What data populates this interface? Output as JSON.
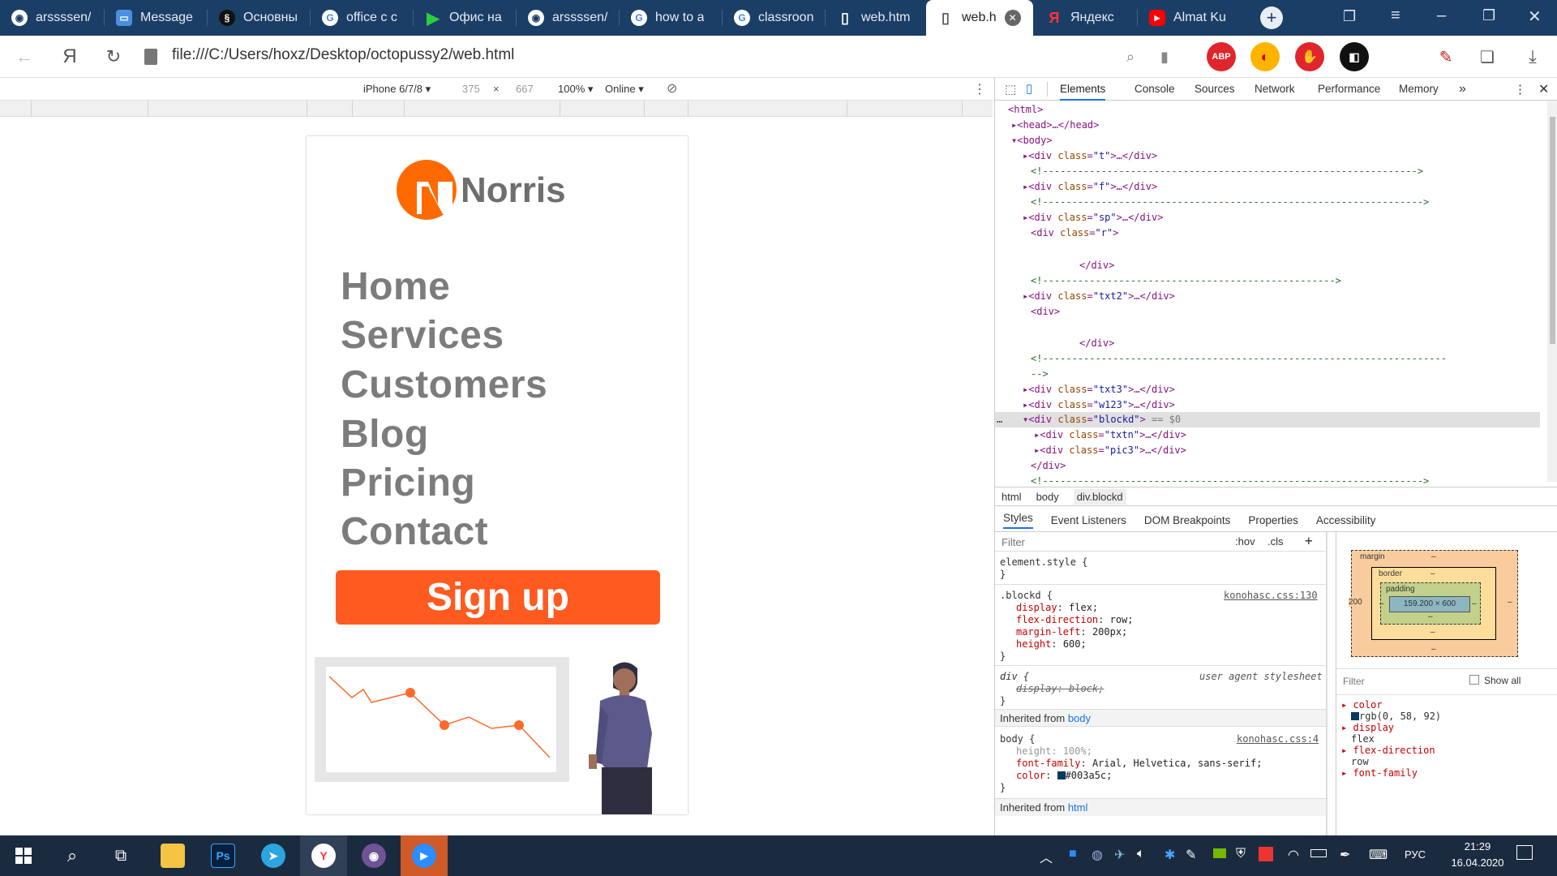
{
  "tabs": [
    {
      "label": "arssssen/",
      "icon": "github-icon"
    },
    {
      "label": "Message",
      "icon": "message-icon"
    },
    {
      "label": "Основны",
      "icon": "app-icon"
    },
    {
      "label": "office с с",
      "icon": "google-icon"
    },
    {
      "label": "Офис на",
      "icon": "play-icon"
    },
    {
      "label": "arssssen/",
      "icon": "github-icon"
    },
    {
      "label": "how to a",
      "icon": "google-icon"
    },
    {
      "label": "classroon",
      "icon": "google-icon"
    },
    {
      "label": "web.htm",
      "icon": "file-icon"
    },
    {
      "label": "web.h",
      "icon": "file-icon"
    },
    {
      "label": "Яндекс",
      "icon": "yandex-icon"
    },
    {
      "label": "Almat Ku",
      "icon": "youtube-icon"
    }
  ],
  "address": {
    "url": "file:///C:/Users/hoxz/Desktop/octopussy2/web.html",
    "yandex_glyph": "Я"
  },
  "extensions": {
    "abp": "ABP"
  },
  "device_toolbar": {
    "device": "iPhone 6/7/8",
    "width": "375",
    "times": "×",
    "height": "667",
    "zoom": "100%",
    "network": "Online"
  },
  "site": {
    "logo_text": "Norris",
    "nav": [
      "Home",
      "Services",
      "Customers",
      "Blog",
      "Pricing",
      "Contact"
    ],
    "signup": "Sign up"
  },
  "devtools": {
    "tabs": [
      "Elements",
      "Console",
      "Sources",
      "Network",
      "Performance",
      "Memory"
    ],
    "more": "»",
    "breadcrumbs": [
      "html",
      "body",
      "div.blockd"
    ],
    "style_tabs": [
      "Styles",
      "Event Listeners",
      "DOM Breakpoints",
      "Properties",
      "Accessibility"
    ],
    "filter_placeholder": "Filter",
    "hov": ":hov",
    "cls": ".cls",
    "element_style": "element.style {",
    "blockd_selector": ".blockd {",
    "blockd_source": "konohasc.css:130",
    "blockd_props": [
      [
        "display",
        "flex;"
      ],
      [
        "flex-direction",
        "row;"
      ],
      [
        "margin-left",
        "200px;"
      ],
      [
        "height",
        "600;"
      ]
    ],
    "ua_selector": "div {",
    "ua_source": "user agent stylesheet",
    "ua_prop": "display: block;",
    "inherited_body": "Inherited from",
    "inherited_body_link": "body",
    "body_selector": "body {",
    "body_source": "konohasc.css:4",
    "body_props": [
      [
        "height",
        "100%;"
      ],
      [
        "font-family",
        "Arial, Helvetica, sans-serif;"
      ],
      [
        "color",
        "#003a5c;"
      ]
    ],
    "inherited_html": "Inherited from",
    "inherited_html_link": "html",
    "box_model": {
      "margin_label": "margin",
      "border_label": "border",
      "padding_label": "padding",
      "margin_left": "200",
      "content": "159.200 × 600",
      "dash": "–"
    },
    "computed_filter": "Filter",
    "show_all": "Show all",
    "computed": [
      [
        "color",
        "rgb(0, 58, 92)"
      ],
      [
        "display",
        "flex"
      ],
      [
        "flex-direction",
        "row"
      ],
      [
        "font-family",
        ""
      ]
    ],
    "close_brace": "}",
    "dom_selected_suffix": "== $0"
  },
  "taskbar": {
    "lang": "РУС",
    "time": "21:29",
    "date": "16.04.2020"
  },
  "colors": {
    "brand_orange": "#ff5a1f",
    "tab_bg": "#1b3e66",
    "taskbar_bg": "#1b2b3f"
  }
}
